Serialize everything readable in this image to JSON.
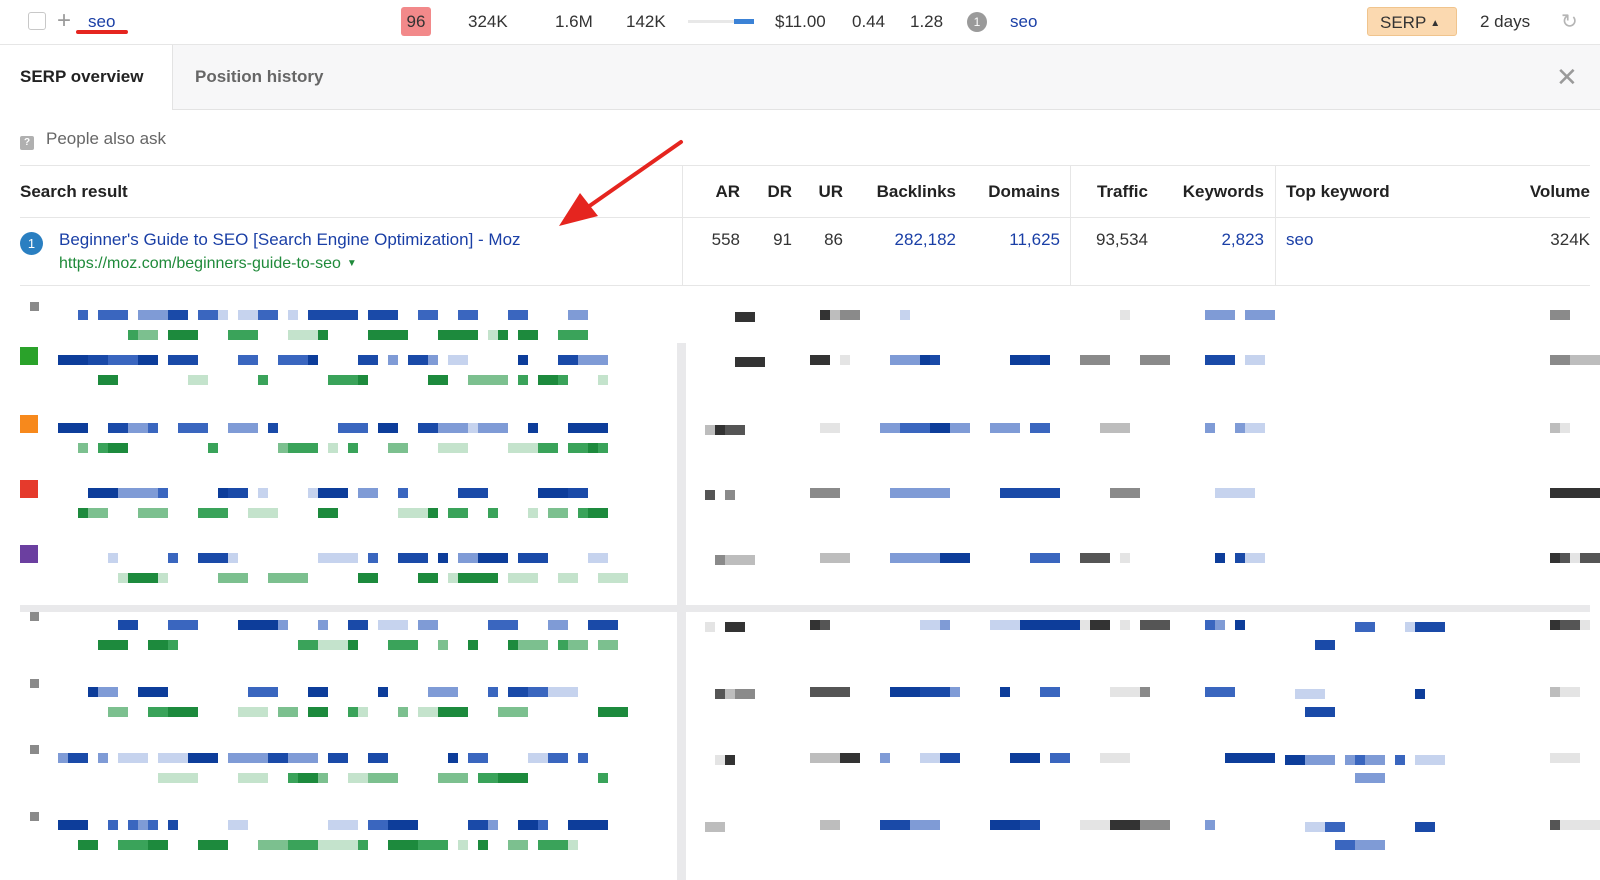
{
  "keyword_row": {
    "keyword": "seo",
    "kd": "96",
    "volume": "324K",
    "global_volume": "1.6M",
    "clicks": "142K",
    "trend_fraction": 0.3,
    "cpc": "$11.00",
    "cps": "0.44",
    "rr": "1.28",
    "result_count": "1",
    "parent_topic": "seo",
    "serp_button_label": "SERP",
    "updated": "2 days"
  },
  "tabs": [
    {
      "label": "SERP overview",
      "active": true
    },
    {
      "label": "Position history",
      "active": false
    }
  ],
  "people_also_ask": "People also ask",
  "table": {
    "headers": {
      "search_result": "Search result",
      "ar": "AR",
      "dr": "DR",
      "ur": "UR",
      "backlinks": "Backlinks",
      "domains": "Domains",
      "traffic": "Traffic",
      "keywords": "Keywords",
      "top_keyword": "Top keyword",
      "volume": "Volume"
    },
    "rows": [
      {
        "rank": "1",
        "title": "Beginner's Guide to SEO [Search Engine Optimization] - Moz",
        "url": "https://moz.com/beginners-guide-to-seo",
        "ar": "558",
        "dr": "91",
        "ur": "86",
        "backlinks": "282,182",
        "domains": "11,625",
        "traffic": "93,534",
        "keywords": "2,823",
        "top_keyword": "seo",
        "volume": "324K"
      }
    ]
  },
  "colors": {
    "link_blue": "#1a3fa6",
    "url_green": "#1f8a3a",
    "kd_badge": "#f2898a",
    "serp_button": "#fbd9b0",
    "annotation_red": "#e5251f",
    "rank_badge": "#2a7fc1"
  },
  "icons": {
    "checkbox": "checkbox-icon",
    "plus": "plus-icon",
    "close": "close-icon",
    "refresh": "refresh-icon",
    "paa": "question-icon",
    "dropdown": "caret-down-icon"
  }
}
